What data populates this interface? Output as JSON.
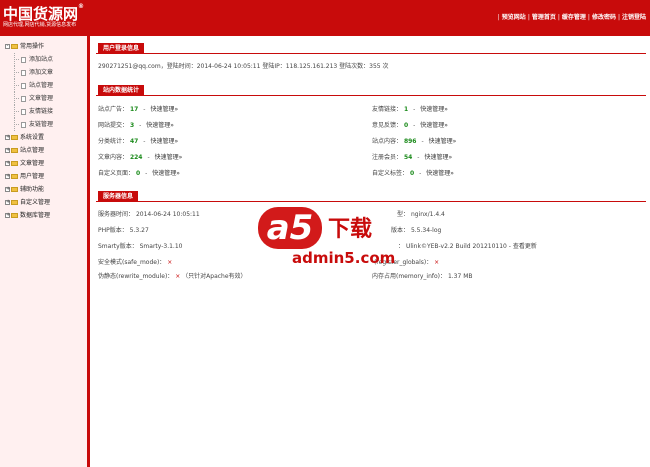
{
  "header": {
    "logo_text": "中国货源网",
    "logo_mark": "®",
    "slogan": "网店代理,网店代销,货源信息发布",
    "nav": [
      "预览网站",
      "管理首页",
      "缓存管理",
      "修改密码",
      "注销登陆"
    ],
    "nav_separator": "|"
  },
  "sidebar": {
    "sections": [
      {
        "label": "常用操作",
        "expander": "-",
        "items": [
          "添加站点",
          "添加文章",
          "站点管理",
          "文章管理",
          "友情链接",
          "友链管理"
        ]
      },
      {
        "label": "系统设置",
        "expander": "+"
      },
      {
        "label": "站点管理",
        "expander": "+"
      },
      {
        "label": "文章管理",
        "expander": "+"
      },
      {
        "label": "用户管理",
        "expander": "+"
      },
      {
        "label": "辅助功能",
        "expander": "+"
      },
      {
        "label": "自定义管理",
        "expander": "+"
      },
      {
        "label": "数据库管理",
        "expander": "+"
      }
    ]
  },
  "login": {
    "tab": "用户登录信息",
    "line": "290271251@qq.com，登陆时间：2014-06-24 10:05:11    登陆IP：118.125.161.213    登陆次数：355 次"
  },
  "stats": {
    "tab": "站内数据统计",
    "quick_label": "快速管理»",
    "separator": "-",
    "left": [
      {
        "label": "站点广告：",
        "value": "17"
      },
      {
        "label": "网站提交：",
        "value": "3"
      },
      {
        "label": "分类统计：",
        "value": "47"
      },
      {
        "label": "文章内容：",
        "value": "224"
      },
      {
        "label": "自定义页面：",
        "value": "0"
      }
    ],
    "right": [
      {
        "label": "友情链接：",
        "value": "1"
      },
      {
        "label": "意见反馈：",
        "value": "0"
      },
      {
        "label": "站点内容：",
        "value": "896"
      },
      {
        "label": "注册会员：",
        "value": "54"
      },
      {
        "label": "自定义标签：",
        "value": "0"
      }
    ]
  },
  "server": {
    "tab": "服务器信息",
    "left": [
      {
        "label": "服务器时间：",
        "value": "2014-06-24  10:05:11",
        "extra": ""
      },
      {
        "label": "PHP版本：",
        "value": "5.3.27",
        "extra": ""
      },
      {
        "label": "Smarty版本：",
        "value": "Smarty-3.1.10",
        "extra": ""
      },
      {
        "label": "安全模式(safe_mode)：",
        "value": "×",
        "extra": ""
      },
      {
        "label": "伪静态(rewrite_module)：",
        "value": "×",
        "extra": "（只针对Apache有效）"
      }
    ],
    "right": [
      {
        "label": "型：",
        "value": "nginx/1.4.4"
      },
      {
        "label": "版本：",
        "value": "5.5.34-log"
      },
      {
        "label": "：",
        "value": "Ulink©YEB-v2.2 Build 201210110 - 查看更新"
      },
      {
        "label": "(register_globals)：",
        "value": "×"
      },
      {
        "label": "内存占用(memory_info)：",
        "value": "1.37 MB"
      }
    ]
  },
  "watermark": {
    "mark": "a5",
    "title": "下载",
    "url": "admin5.com"
  },
  "colors": {
    "primary": "#c80b0b",
    "sidebar_bg": "#fff0f0",
    "value_green": "#1a8a1a"
  }
}
